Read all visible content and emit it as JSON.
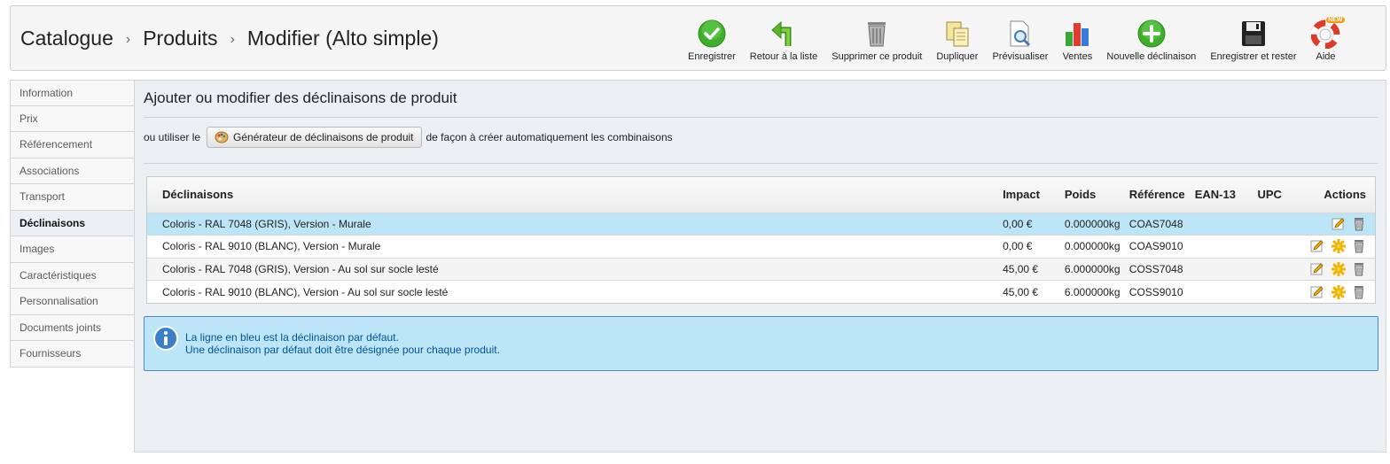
{
  "breadcrumb": {
    "level1": "Catalogue",
    "level2": "Produits",
    "level3": "Modifier (Alto simple)",
    "separator": "›"
  },
  "toolbar": {
    "save": "Enregistrer",
    "back": "Retour à la liste",
    "delete": "Supprimer ce produit",
    "duplicate": "Dupliquer",
    "preview": "Prévisualiser",
    "sales": "Ventes",
    "new_combination": "Nouvelle déclinaison",
    "save_stay": "Enregistrer et rester",
    "help": "Aide",
    "help_badge": "NEW"
  },
  "sidebar": {
    "items": [
      {
        "label": "Information"
      },
      {
        "label": "Prix"
      },
      {
        "label": "Référencement"
      },
      {
        "label": "Associations"
      },
      {
        "label": "Transport"
      },
      {
        "label": "Déclinaisons"
      },
      {
        "label": "Images"
      },
      {
        "label": "Caractéristiques"
      },
      {
        "label": "Personnalisation"
      },
      {
        "label": "Documents joints"
      },
      {
        "label": "Fournisseurs"
      }
    ],
    "active_index": 5
  },
  "main": {
    "title": "Ajouter ou modifier des déclinaisons de produit",
    "generator_prefix": "ou utiliser le",
    "generator_button": "Générateur de déclinaisons de produit",
    "generator_suffix": "de façon à créer automatiquement les combinaisons"
  },
  "table": {
    "headers": {
      "combination": "Déclinaisons",
      "impact": "Impact",
      "weight": "Poids",
      "reference": "Référence",
      "ean": "EAN-13",
      "upc": "UPC",
      "actions": "Actions"
    },
    "rows": [
      {
        "combination": "Coloris - RAL 7048 (GRIS), Version - Murale",
        "impact": "0,00 €",
        "weight": "0.000000kg",
        "reference": "COAS7048",
        "ean": "",
        "upc": ""
      },
      {
        "combination": "Coloris - RAL 9010 (BLANC), Version - Murale",
        "impact": "0,00 €",
        "weight": "0.000000kg",
        "reference": "COAS9010",
        "ean": "",
        "upc": ""
      },
      {
        "combination": "Coloris - RAL 7048 (GRIS), Version - Au sol sur socle lesté",
        "impact": "45,00 €",
        "weight": "6.000000kg",
        "reference": "COSS7048",
        "ean": "",
        "upc": ""
      },
      {
        "combination": "Coloris - RAL 9010 (BLANC), Version - Au sol sur socle lesté",
        "impact": "45,00 €",
        "weight": "6.000000kg",
        "reference": "COSS9010",
        "ean": "",
        "upc": ""
      }
    ]
  },
  "info": {
    "line1": "La ligne en bleu est la déclinaison par défaut.",
    "line2": "Une déclinaison par défaut doit être désignée pour chaque produit."
  },
  "colors": {
    "default_row": "#bde5f8",
    "info_text": "#00529b",
    "info_border": "#4b8dc5"
  }
}
